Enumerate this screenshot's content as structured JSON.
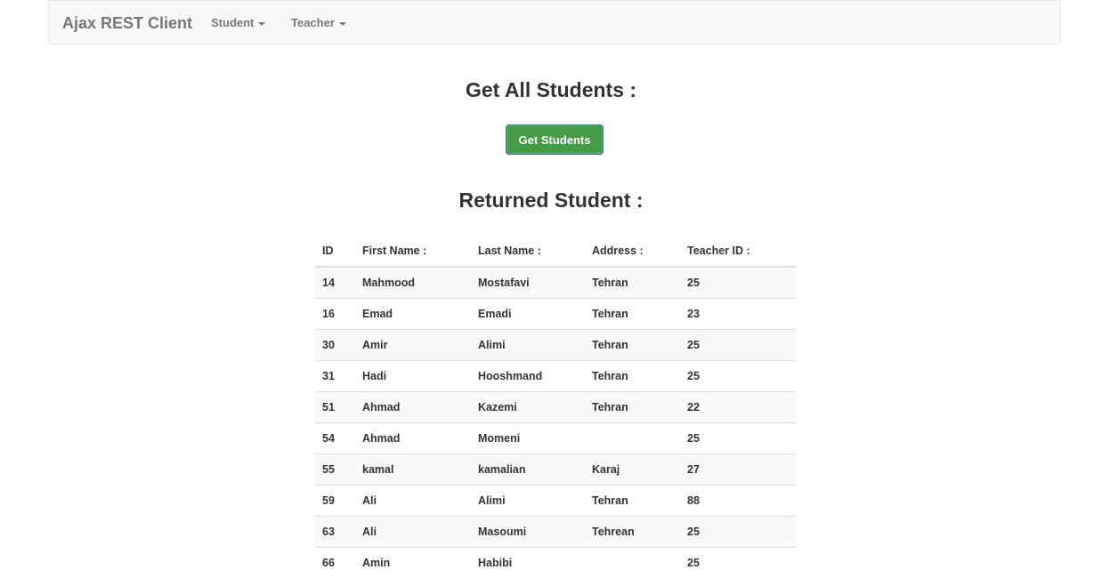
{
  "navbar": {
    "brand": "Ajax REST Client",
    "menus": [
      {
        "label": "Student"
      },
      {
        "label": "Teacher"
      }
    ]
  },
  "section_get": {
    "title": "Get All Students :",
    "button_label": "Get Students",
    "button_color": "#449d44"
  },
  "section_returned": {
    "title": "Returned Student :"
  },
  "table": {
    "headers": [
      "ID",
      "First Name :",
      "Last Name :",
      "Address :",
      "Teacher ID :"
    ],
    "rows": [
      [
        "14",
        "Mahmood",
        "Mostafavi",
        "Tehran",
        "25"
      ],
      [
        "16",
        "Emad",
        "Emadi",
        "Tehran",
        "23"
      ],
      [
        "30",
        "Amir",
        "Alimi",
        "Tehran",
        "25"
      ],
      [
        "31",
        "Hadi",
        "Hooshmand",
        "Tehran",
        "25"
      ],
      [
        "51",
        "Ahmad",
        "Kazemi",
        "Tehran",
        "22"
      ],
      [
        "54",
        "Ahmad",
        "Momeni",
        "",
        "25"
      ],
      [
        "55",
        "kamal",
        "kamalian",
        "Karaj",
        "27"
      ],
      [
        "59",
        "Ali",
        "Alimi",
        "Tehran",
        "88"
      ],
      [
        "63",
        "Ali",
        "Masoumi",
        "Tehrean",
        "25"
      ],
      [
        "66",
        "Amin",
        "Habibi",
        "",
        "25"
      ]
    ]
  }
}
